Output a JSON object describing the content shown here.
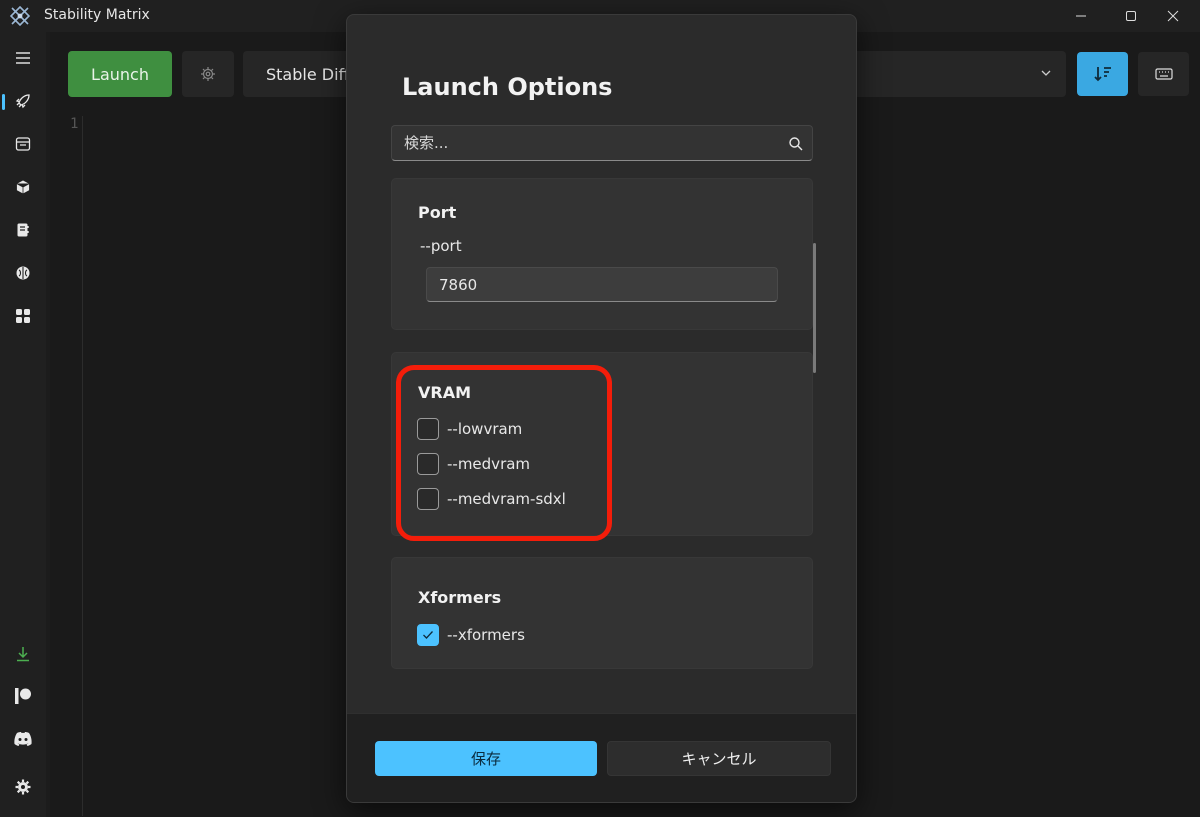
{
  "window": {
    "title": "Stability Matrix"
  },
  "toolbar": {
    "launch_label": "Launch",
    "package_name": "Stable Diffu"
  },
  "editor": {
    "line_number": "1"
  },
  "dialog": {
    "title": "Launch Options",
    "search_placeholder": "検索...",
    "port": {
      "title": "Port",
      "arg": "--port",
      "value": "7860"
    },
    "vram": {
      "title": "VRAM",
      "options": [
        {
          "label": "--lowvram",
          "checked": false
        },
        {
          "label": "--medvram",
          "checked": false
        },
        {
          "label": "--medvram-sdxl",
          "checked": false
        }
      ]
    },
    "xformers": {
      "title": "Xformers",
      "options": [
        {
          "label": "--xformers",
          "checked": true
        }
      ]
    },
    "save_label": "保存",
    "cancel_label": "キャンセル"
  },
  "colors": {
    "accent": "#4cc2ff",
    "launch": "#3f8f40",
    "highlight": "#f41d0a"
  }
}
